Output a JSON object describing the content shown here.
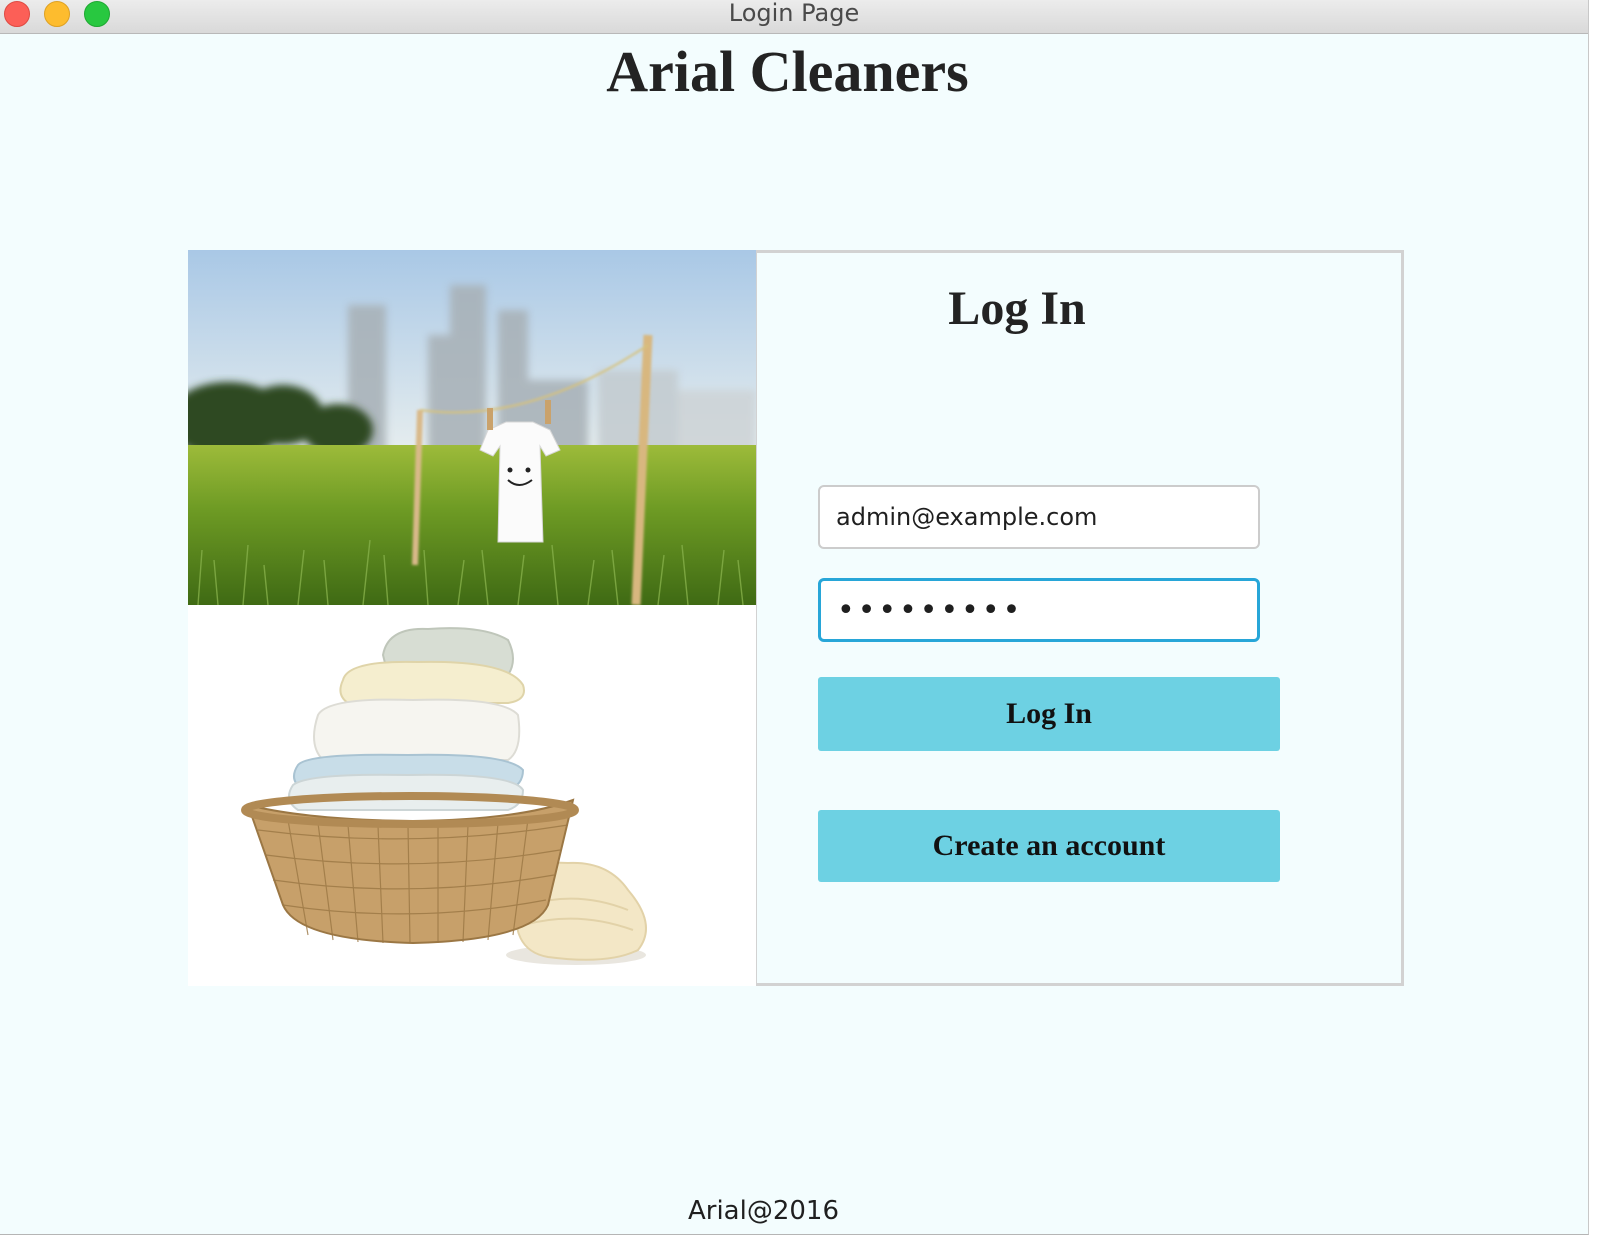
{
  "window": {
    "title": "Login Page"
  },
  "app": {
    "title": "Arial Cleaners"
  },
  "login": {
    "heading": "Log In",
    "email_value": "admin@example.com",
    "password_value": "•••••••••",
    "login_button": "Log In",
    "create_account_button": "Create an account"
  },
  "footer": {
    "text": "Arial@2016"
  },
  "colors": {
    "background": "#f3fdfe",
    "button": "#6dd1e3",
    "focus_border": "#27a6d8"
  },
  "icons": {
    "close": "close-icon",
    "minimize": "minimize-icon",
    "zoom": "zoom-icon"
  }
}
